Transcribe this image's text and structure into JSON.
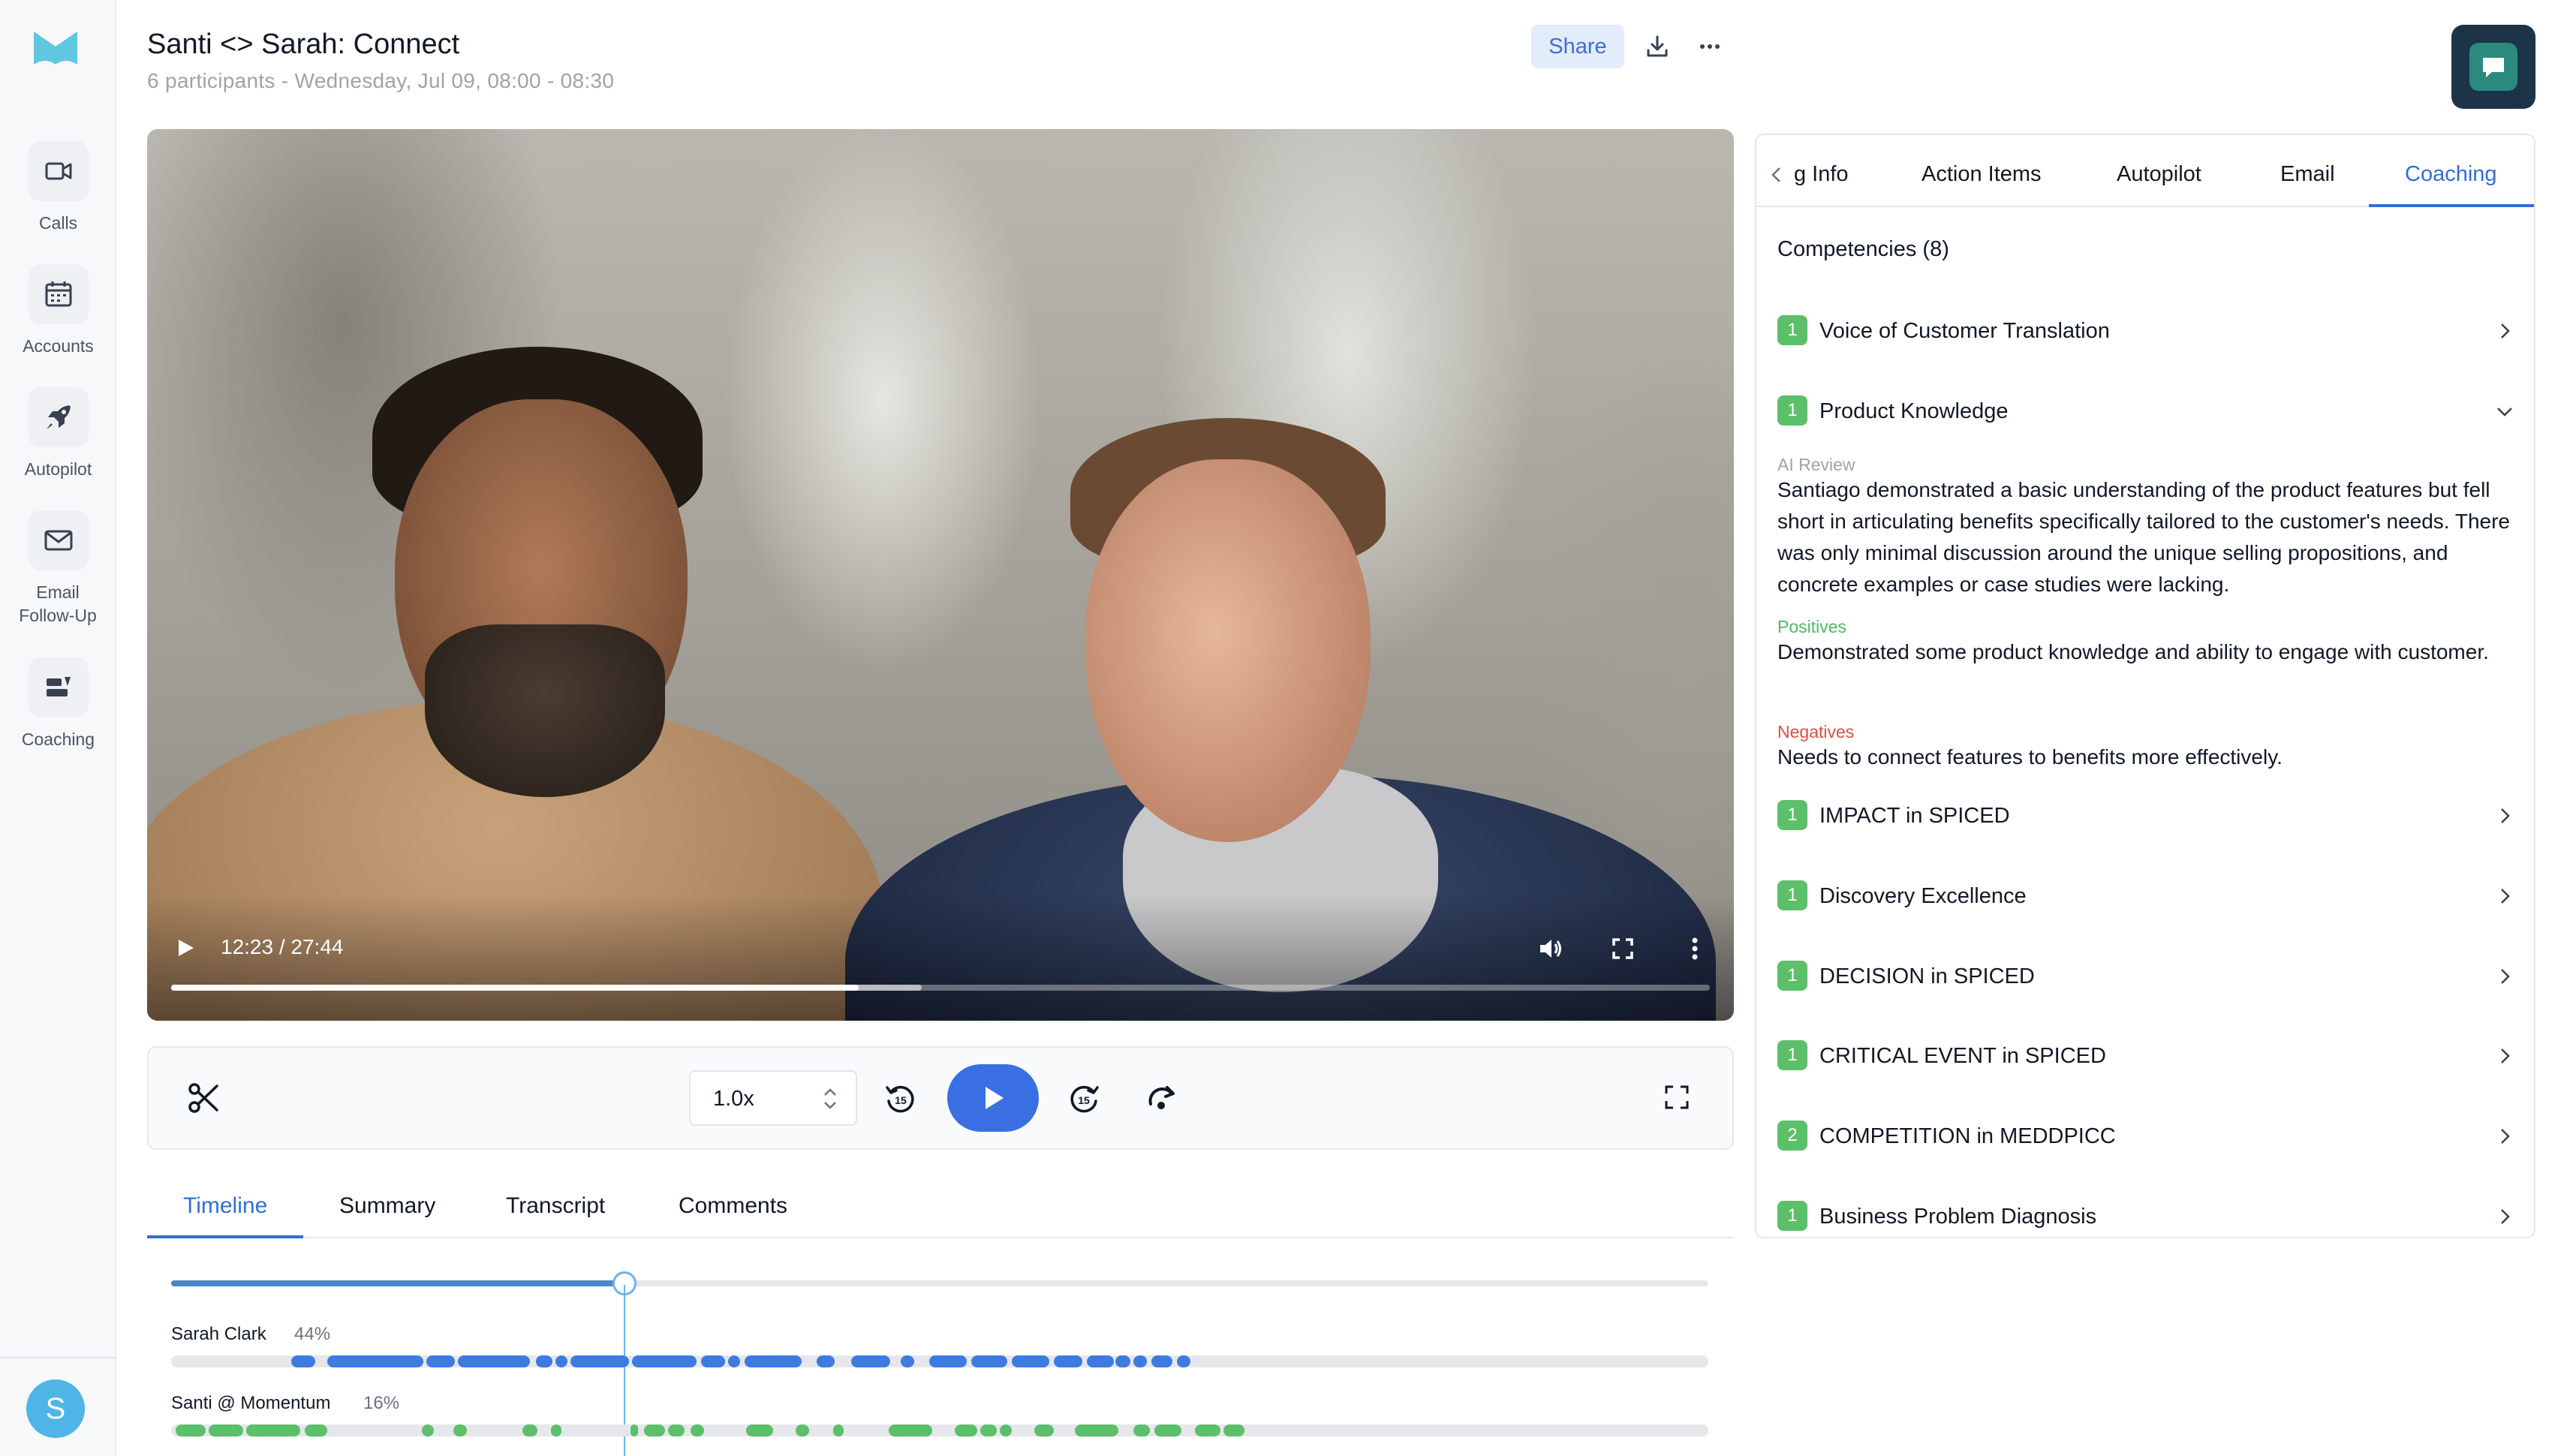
{
  "sidebar": {
    "items": [
      {
        "label": "Calls",
        "icon": "video-camera-icon"
      },
      {
        "label": "Accounts",
        "icon": "calendar-grid-icon"
      },
      {
        "label": "Autopilot",
        "icon": "rocket-icon"
      },
      {
        "label": "Email Follow-Up",
        "icon": "envelope-icon"
      },
      {
        "label": "Coaching",
        "icon": "coaching-icon"
      }
    ],
    "avatar_initial": "S"
  },
  "header": {
    "title": "Santi <> Sarah: Connect",
    "subtitle": "6 participants - Wednesday, Jul 09, 08:00 - 08:30",
    "share_label": "Share"
  },
  "video": {
    "time_display": "12:23 / 27:44",
    "progress": 0.447,
    "buffered": 0.488
  },
  "player": {
    "speed": "1.0x"
  },
  "tabs": [
    {
      "label": "Timeline",
      "active": true
    },
    {
      "label": "Summary",
      "active": false
    },
    {
      "label": "Transcript",
      "active": false
    },
    {
      "label": "Comments",
      "active": false
    }
  ],
  "timeline": {
    "position": 0.295,
    "speakers": [
      {
        "name": "Sarah Clark",
        "percent": "44%",
        "color": "#3e7be0"
      },
      {
        "name": "Santi @ Momentum",
        "percent": "16%",
        "color": "#5cbf6a"
      }
    ]
  },
  "panel": {
    "tabs": [
      {
        "label": "g Info",
        "active": false
      },
      {
        "label": "Action Items",
        "active": false
      },
      {
        "label": "Autopilot",
        "active": false
      },
      {
        "label": "Email",
        "active": false
      },
      {
        "label": "Coaching",
        "active": true
      }
    ],
    "section_title": "Competencies (8)",
    "competencies": [
      {
        "score": "1",
        "label": "Voice of Customer Translation"
      },
      {
        "score": "1",
        "label": "Product Knowledge"
      },
      {
        "score": "1",
        "label": "IMPACT in SPICED"
      },
      {
        "score": "1",
        "label": "Discovery Excellence"
      },
      {
        "score": "1",
        "label": "DECISION in SPICED"
      },
      {
        "score": "1",
        "label": "CRITICAL EVENT in SPICED"
      },
      {
        "score": "2",
        "label": "COMPETITION in MEDDPICC"
      },
      {
        "score": "1",
        "label": "Business Problem Diagnosis"
      }
    ],
    "review": {
      "ai_label": "AI Review",
      "ai_text": "Santiago demonstrated a basic understanding of the product features but fell short in articulating benefits specifically tailored to the customer's needs. There was only minimal discussion around the unique selling propositions, and concrete examples or case studies were lacking.",
      "positives_label": "Positives",
      "positives_text": "Demonstrated some product knowledge and ability to engage with customer.",
      "negatives_label": "Negatives",
      "negatives_text": "Needs to connect features to benefits more effectively."
    },
    "colors": {
      "positive": "#4fb863",
      "negative": "#d9503f",
      "muted": "#9ca3af",
      "accent": "#2f6fd6"
    }
  }
}
